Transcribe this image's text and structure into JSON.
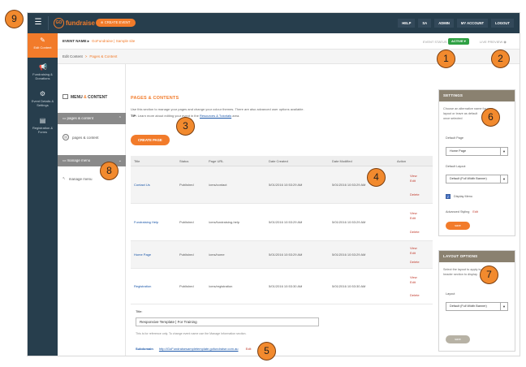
{
  "topbar": {
    "logo_text": "fundraise",
    "create_event_label": "CREATE EVENT",
    "nav": [
      "HELP",
      "SA",
      "ADMIN",
      "MY ACCOUNT",
      "LOGOUT"
    ]
  },
  "sidebar": {
    "items": [
      {
        "label": "Edit Content",
        "icon": "edit-icon",
        "active": true
      },
      {
        "label": "Fundraising & Donations",
        "icon": "megaphone-icon",
        "active": false
      },
      {
        "label": "Event Details & Settings",
        "icon": "gear-icon",
        "active": false
      },
      {
        "label": "Registration & Forms",
        "icon": "clipboard-icon",
        "active": false
      }
    ]
  },
  "event": {
    "label": "EVENT NAME",
    "name": "GoFundraise | Sample site",
    "status_label": "EVENT STATUS",
    "status": "ACTIVE",
    "live_preview": "LIVE PREVIEW"
  },
  "breadcrumb": {
    "root": "Edit Content",
    "separator": ">",
    "leaf": "Pages & Content"
  },
  "subpanel": {
    "title_a": "MENU",
    "title_amp": "&",
    "title_b": "CONTENT",
    "group1": "pages & content",
    "item1": "pages & content",
    "group2": "manage menu",
    "item2": "manage menu"
  },
  "main": {
    "heading": "PAGES & CONTENTS",
    "intro": "Use this section to manage your pages and change your colour themes. There are also advanced user options available.",
    "tip_label": "TIP:",
    "tip_text": "Learn more about editing your event in the",
    "tip_link": "Resources & Tutorials",
    "tip_end": "area.",
    "create_page": "CREATE PAGE",
    "columns": [
      "Title",
      "Status",
      "Page URL",
      "Date Created",
      "Date Modified",
      "Action"
    ],
    "rows": [
      {
        "title": "Contact Us",
        "status": "Published",
        "url": "/cms/contact",
        "created": "5/01/2016 10:53:29 AM",
        "modified": "5/01/2016 10:53:29 AM"
      },
      {
        "title": "Fundraising Help",
        "status": "Published",
        "url": "/cms/fundraising-help",
        "created": "5/01/2016 10:53:29 AM",
        "modified": "5/01/2016 10:53:29 AM"
      },
      {
        "title": "Home Page",
        "status": "Published",
        "url": "/cms/home",
        "created": "5/01/2016 10:53:29 AM",
        "modified": "5/01/2016 10:53:29 AM"
      },
      {
        "title": "Registration",
        "status": "Published",
        "url": "/cms/registration",
        "created": "5/01/2016 10:53:30 AM",
        "modified": "5/01/2016 10:53:30 AM"
      }
    ],
    "actions": {
      "view": "View",
      "edit": "Edit",
      "delete": "Delete"
    },
    "title_field_label": "Title:",
    "title_field_value": "Responsive Template | For Training",
    "title_note": "This is for reference only. To change event name use the Manage Information section.",
    "subdomain_label": "Subdomain",
    "subdomain_link": "http://GoFundraisesampletemplate.gofundraise.com.au",
    "subdomain_edit": "Edit"
  },
  "settings": {
    "heading": "SETTINGS",
    "desc1": "Choose an alternative name for your",
    "desc2": "layout or leave as default",
    "desc3": "once selected",
    "default_page_label": "Default Page",
    "default_page_value": "Home Page",
    "default_layout_label": "Default Layout",
    "default_layout_value": "Default (Full Width Banner)",
    "display_menu": "Display Menu",
    "advanced_styling": "Advanced Styling",
    "advanced_edit": "Edit",
    "save": "save"
  },
  "layout_options": {
    "heading": "LAYOUT OPTIONS",
    "desc1": "Select the layout to apply to",
    "desc2": "header section to display",
    "layout_label": "Layout",
    "layout_value": "Default (Full Width Banner)",
    "save": "save"
  },
  "callouts": [
    "9",
    "1",
    "2",
    "3",
    "4",
    "5",
    "6",
    "7",
    "8"
  ]
}
